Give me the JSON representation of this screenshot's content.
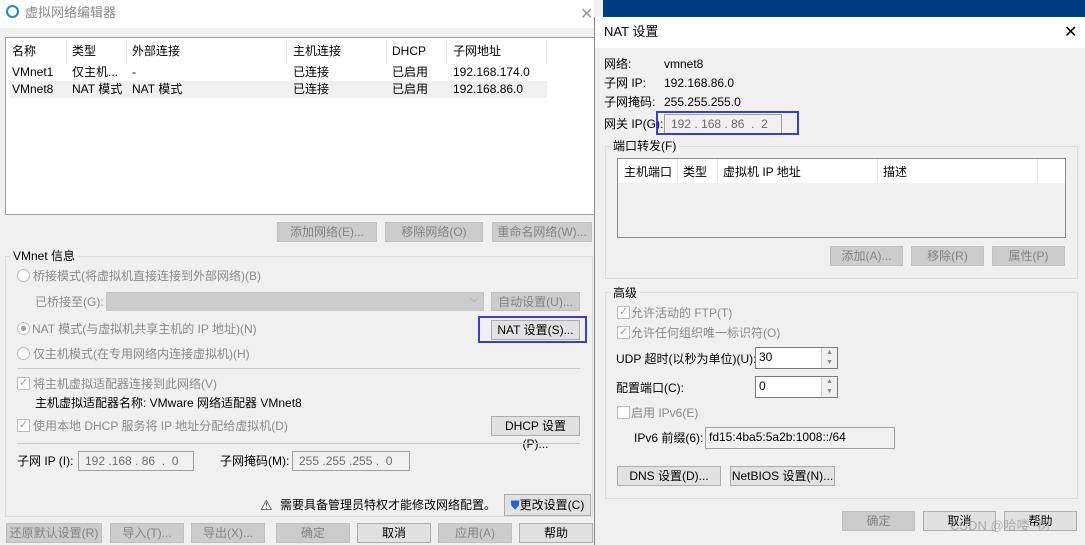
{
  "left": {
    "title": "虚拟网络编辑器",
    "columns": [
      "名称",
      "类型",
      "外部连接",
      "主机连接",
      "DHCP",
      "子网地址"
    ],
    "rows": [
      [
        "VMnet1",
        "仅主机...",
        "-",
        "已连接",
        "已启用",
        "192.168.174.0"
      ],
      [
        "VMnet8",
        "NAT 模式",
        "NAT 模式",
        "已连接",
        "已启用",
        "192.168.86.0"
      ]
    ],
    "add_network": "添加网络(E)...",
    "remove_network": "移除网络(O)",
    "rename_network": "重命名网络(W)...",
    "group_label": "VMnet 信息",
    "bridged": "桥接模式(将虚拟机直接连接到外部网络)(B)",
    "bridged_to": "已桥接至(G):",
    "auto_settings": "自动设置(U)...",
    "nat": "NAT 模式(与虚拟机共享主机的 IP 地址)(N)",
    "nat_settings": "NAT 设置(S)...",
    "host_only": "仅主机模式(在专用网络内连接虚拟机)(H)",
    "connect_adapter": "将主机虚拟适配器连接到此网络(V)",
    "adapter_name": "主机虚拟适配器名称: VMware 网络适配器 VMnet8",
    "use_dhcp": "使用本地 DHCP 服务将 IP 地址分配给虚拟机(D)",
    "dhcp_settings": "DHCP 设置(P)...",
    "subnet_ip_label": "子网 IP (I):",
    "subnet_ip": "192 .168 . 86  .  0",
    "subnet_mask_label": "子网掩码(M):",
    "subnet_mask": "255 .255 .255 .  0",
    "warning": "需要具备管理员特权才能修改网络配置。",
    "change_settings": "更改设置(C)",
    "restore": "还原默认设置(R)",
    "import": "导入(T)...",
    "export": "导出(X)...",
    "ok": "确定",
    "cancel": "取消",
    "apply": "应用(A)",
    "help": "帮助"
  },
  "nat": {
    "title": "NAT 设置",
    "network_label": "网络:",
    "network": "vmnet8",
    "subnet_ip_label": "子网 IP:",
    "subnet_ip": "192.168.86.0",
    "subnet_mask_label": "子网掩码:",
    "subnet_mask": "255.255.255.0",
    "gateway_label": "网关 IP(G):",
    "gateway": "192 . 168 . 86  .  2",
    "port_forward_label": "端口转发(F)",
    "pf_columns": [
      "主机端口",
      "类型",
      "虚拟机 IP 地址",
      "描述"
    ],
    "add": "添加(A)...",
    "remove": "移除(R)",
    "properties": "属性(P)",
    "advanced_label": "高级",
    "allow_ftp": "允许活动的 FTP(T)",
    "allow_oui": "允许任何组织唯一标识符(O)",
    "udp_label": "UDP 超时(以秒为单位)(U):",
    "udp": "30",
    "config_port_label": "配置端口(C):",
    "config_port": "0",
    "enable_ipv6": "启用 IPv6(E)",
    "ipv6_label": "IPv6 前缀(6):",
    "ipv6": "fd15:4ba5:5a2b:1008::/64",
    "dns": "DNS 设置(D)...",
    "netbios": "NetBIOS 设置(N)...",
    "ok": "确定",
    "cancel": "取消",
    "help": "帮助"
  },
  "watermark": "CSDN @哈喽~树"
}
